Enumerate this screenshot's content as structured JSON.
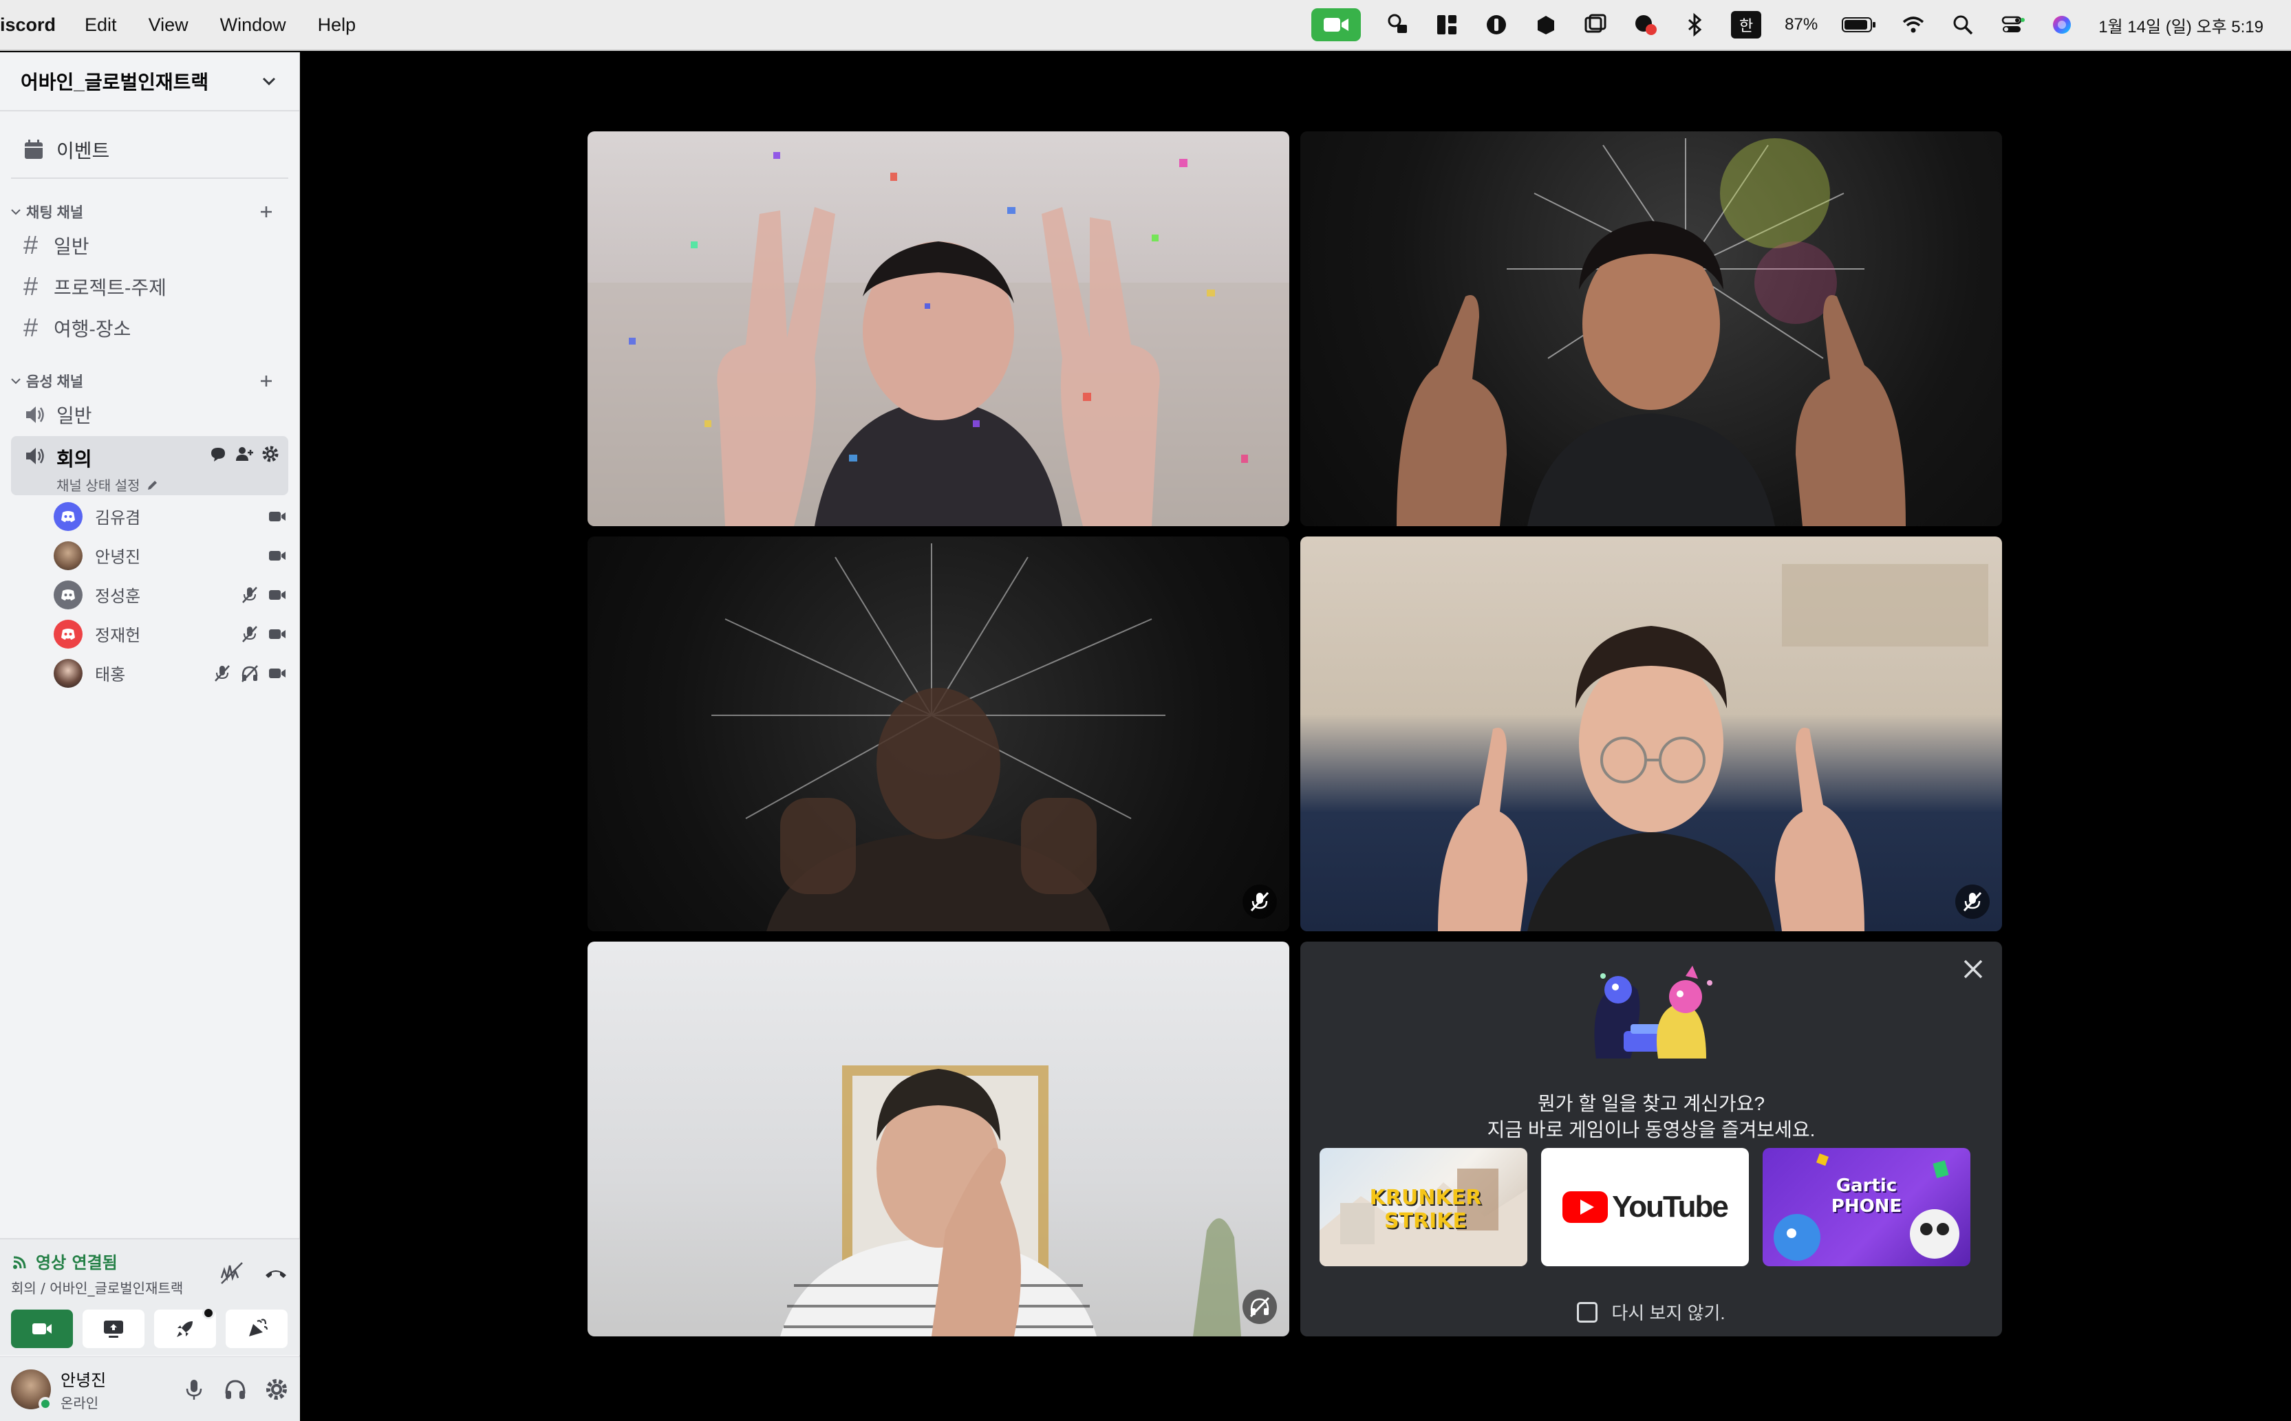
{
  "menubar": {
    "app_name": "iscord",
    "items": [
      "Edit",
      "View",
      "Window",
      "Help"
    ],
    "battery": "87%",
    "ime": "한",
    "datetime": "1월 14일 (일) 오후 5:19"
  },
  "sidebar": {
    "server_name": "어바인_글로벌인재트랙",
    "events_label": "이벤트",
    "text_category": "채팅 채널",
    "text_channels": [
      "일반",
      "프로젝트-주제",
      "여행-장소"
    ],
    "voice_category": "음성 채널",
    "voice_channels": [
      "일반"
    ],
    "active_voice": {
      "name": "회의",
      "status": "채널 상태 설정"
    },
    "voice_users": [
      "김유겸",
      "안녕진",
      "정성훈",
      "정재헌",
      "태홍"
    ]
  },
  "voice_panel": {
    "status": "영상 연결됨",
    "location": "회의 / 어바인_글로벌인재트랙"
  },
  "user_panel": {
    "name": "안녕진",
    "status": "온라인"
  },
  "promo": {
    "line1": "뭔가 할 일을 찾고 계신가요?",
    "line2": "지금 바로 게임이나 동영상을 즐겨보세요.",
    "cards": [
      "KRUNKER STRIKE",
      "YouTube",
      "Gartic PHONE"
    ],
    "dont_show": "다시 보지 않기."
  },
  "colors": {
    "accent_green": "#248046",
    "sidebar_bg": "#f2f3f5",
    "discord_blurple": "#5865f2",
    "discord_red": "#ed4245",
    "promo_bg": "#2b2d31"
  }
}
